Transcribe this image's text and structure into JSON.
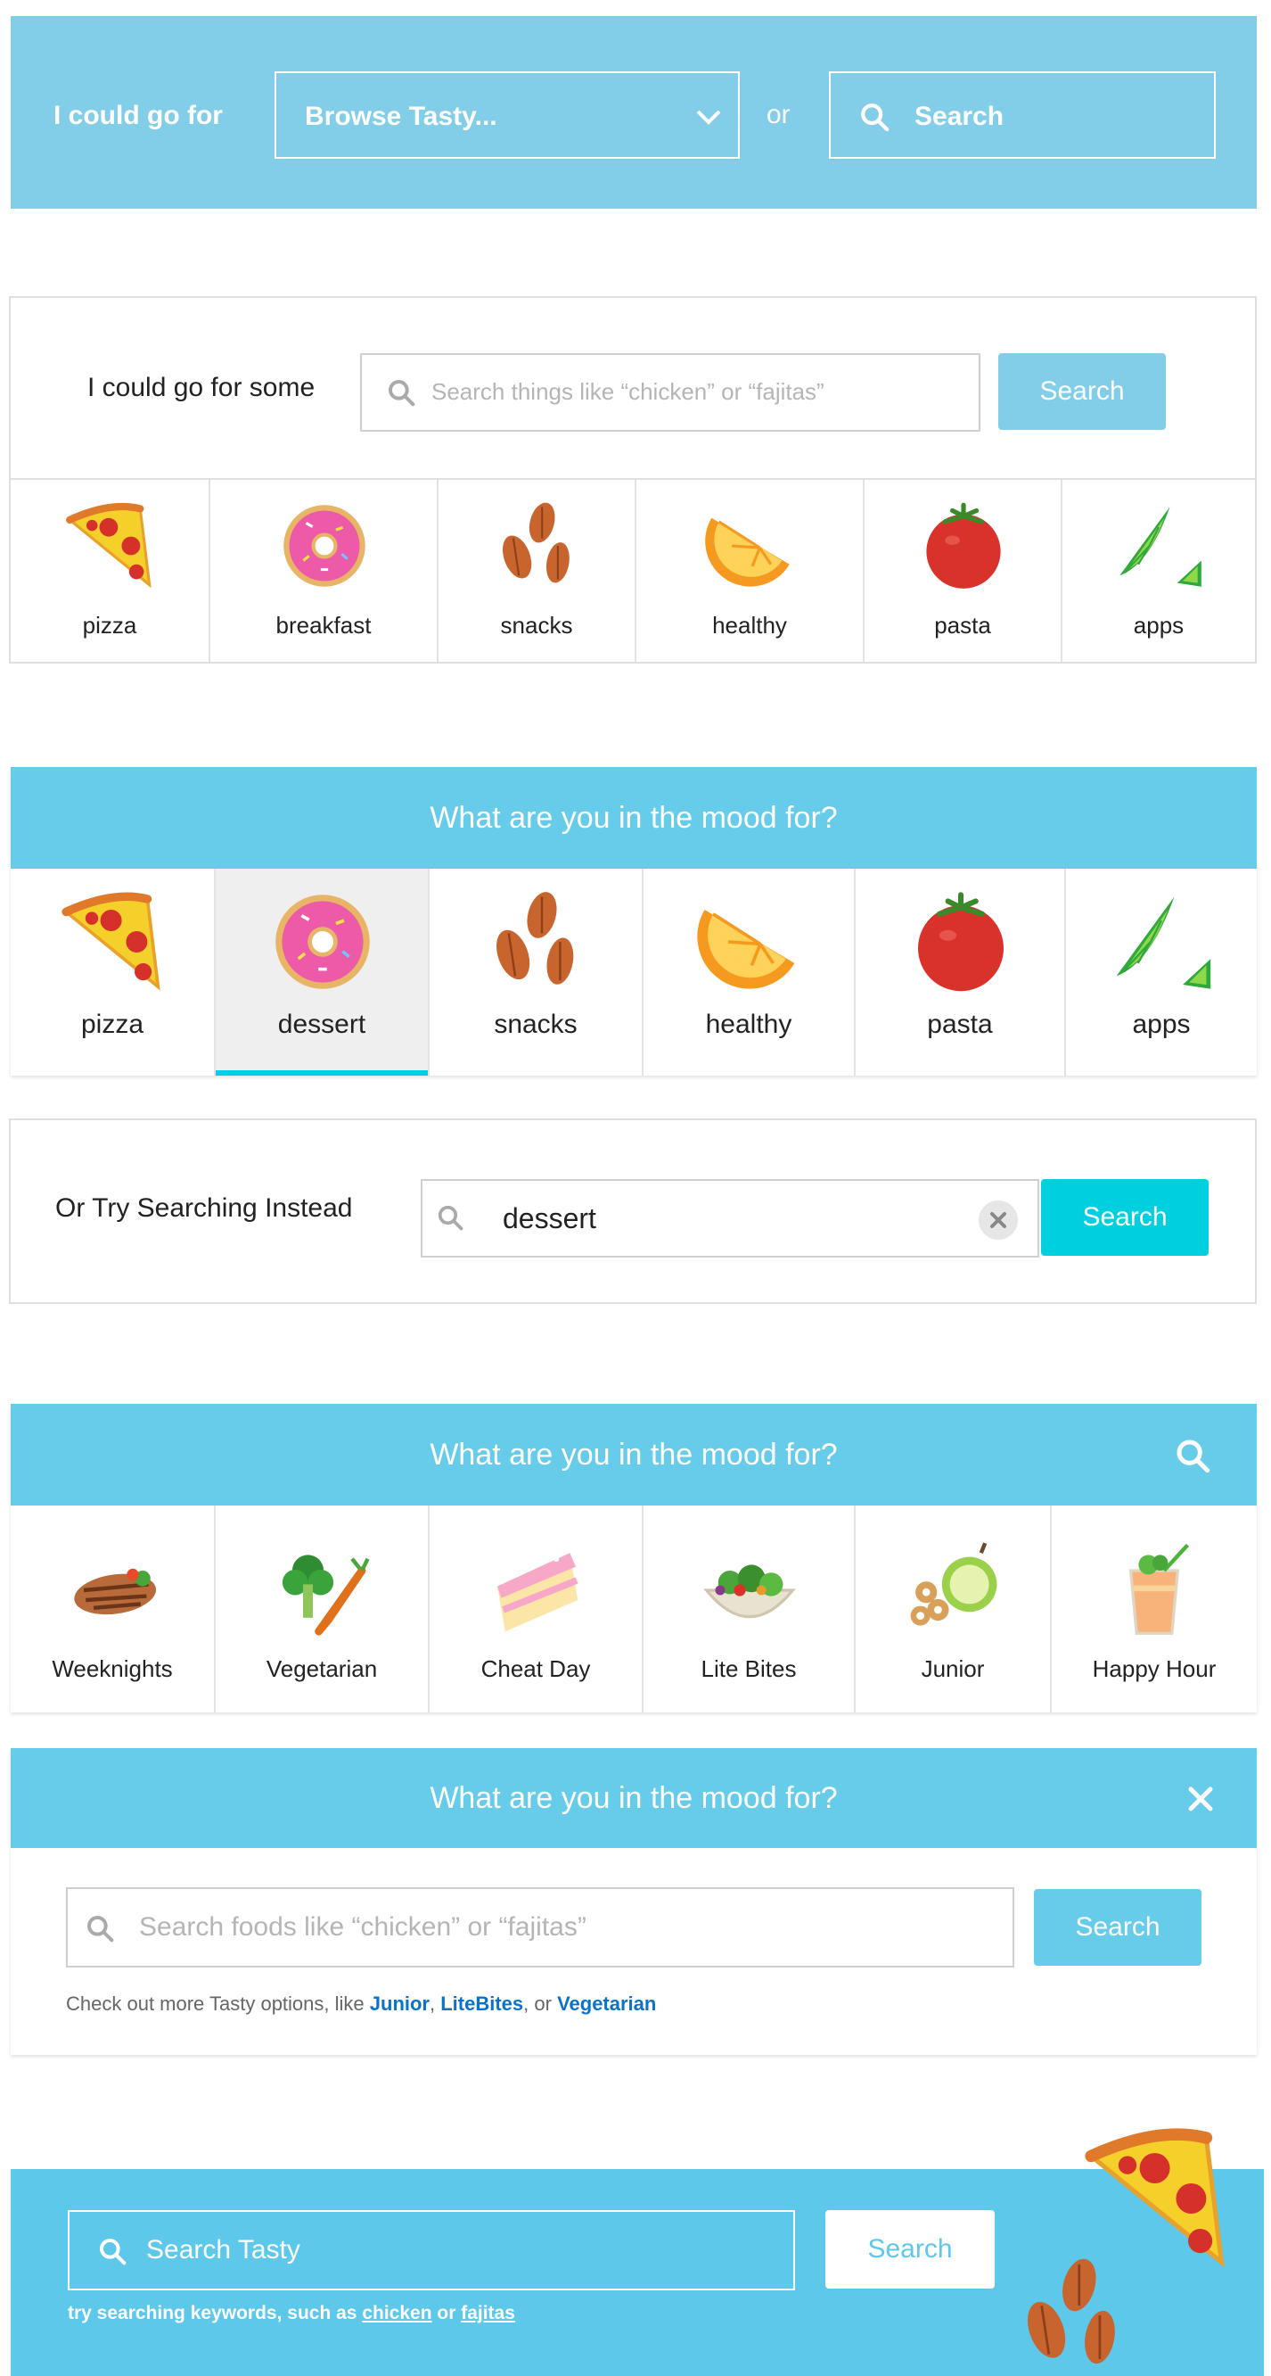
{
  "s1": {
    "label": "I could go for",
    "browse": "Browse Tasty...",
    "or": "or",
    "search": "Search"
  },
  "s2": {
    "label": "I could go for some",
    "placeholder": "Search things like “chicken” or “fajitas”",
    "button": "Search",
    "items": [
      {
        "label": "pizza",
        "icon": "pizza-icon"
      },
      {
        "label": "breakfast",
        "icon": "donut-icon"
      },
      {
        "label": "snacks",
        "icon": "almonds-icon"
      },
      {
        "label": "healthy",
        "icon": "orange-icon"
      },
      {
        "label": "pasta",
        "icon": "tomato-icon"
      },
      {
        "label": "apps",
        "icon": "lime-icon"
      }
    ]
  },
  "s3": {
    "title": "What are you in the mood for?",
    "items": [
      {
        "label": "pizza",
        "icon": "pizza-icon"
      },
      {
        "label": "dessert",
        "icon": "donut-icon"
      },
      {
        "label": "snacks",
        "icon": "almonds-icon"
      },
      {
        "label": "healthy",
        "icon": "orange-icon"
      },
      {
        "label": "pasta",
        "icon": "tomato-icon"
      },
      {
        "label": "apps",
        "icon": "lime-icon"
      }
    ],
    "selected": "dessert"
  },
  "s4": {
    "label": "Or Try Searching Instead",
    "value": "dessert",
    "button": "Search"
  },
  "s5": {
    "title": "What are you in the mood for?",
    "items": [
      {
        "label": "Weeknights",
        "icon": "grilled-chicken-icon"
      },
      {
        "label": "Vegetarian",
        "icon": "vegetables-icon"
      },
      {
        "label": "Cheat Day",
        "icon": "cake-icon"
      },
      {
        "label": "Lite Bites",
        "icon": "salad-icon"
      },
      {
        "label": "Junior",
        "icon": "apple-cereal-icon"
      },
      {
        "label": "Happy Hour",
        "icon": "cocktail-icon"
      }
    ]
  },
  "s6": {
    "title": "What are you in the mood for?",
    "placeholder": "Search foods like “chicken” or “fajitas”",
    "button": "Search",
    "hint_prefix": "Check out more Tasty options, like ",
    "link1": "Junior",
    "comma": ", ",
    "link2": "LiteBites",
    "or": ", or ",
    "link3": "Vegetarian"
  },
  "s7": {
    "placeholder": "Search Tasty",
    "button": "Search",
    "hint_prefix": "try searching keywords, such as ",
    "kw1": "chicken",
    "or": " or ",
    "kw2": "fajitas"
  },
  "colors": {
    "light_blue": "#82cee8",
    "bright_blue": "#67cce9",
    "teal": "#00cfe0",
    "link": "#0a73c9"
  }
}
